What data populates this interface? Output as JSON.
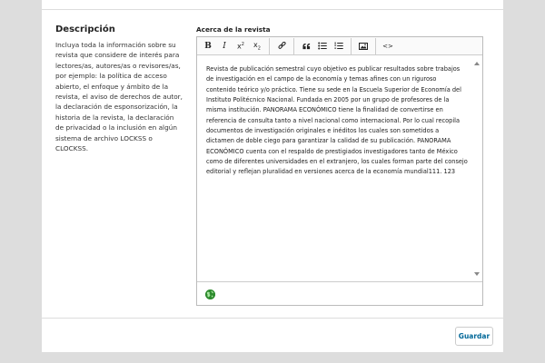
{
  "section": {
    "title": "Descripción",
    "description": "Incluya toda la información sobre su revista que considere de interés para lectores/as, autores/as o revisores/as, por ejemplo: la política de acceso abierto, el enfoque y ámbito de la revista, el aviso de derechos de autor, la declaración de esponsorización, la historia de la revista, la declaración de privacidad o la inclusión en algún sistema de archivo LOCKSS o CLOCKSS."
  },
  "field": {
    "label": "Acerca de la revista",
    "content": "Revista de publicación semestral cuyo objetivo es publicar resultados sobre trabajos de investigación en el campo de la economía y temas afines con un riguroso contenido teórico y/o práctico. Tiene su sede en la Escuela Superior de Economía del Instituto Politécnico Nacional. Fundada en 2005 por un grupo de profesores de la misma institución. PANORAMA ECONÓMICO tiene la finalidad de convertirse en referencia de consulta tanto a nivel nacional como internacional. Por lo cual recopila documentos de investigación originales e inéditos los cuales son sometidos a dictamen de doble ciego para garantizar la calidad de su publicación. PANORAMA ECONÓMICO cuenta con el respaldo de prestigiados investigadores tanto de México como de diferentes universidades en el extranjero, los cuales forman parte del consejo editorial y reflejan pluralidad en versiones acerca de la economía mundial111. 123"
  },
  "toolbar": {
    "bold": "B",
    "italic": "I",
    "superscript": "x",
    "superscript_mark": "2",
    "subscript": "x",
    "subscript_mark": "2",
    "code": "<>"
  },
  "icons": {
    "bold": "bold-icon",
    "italic": "italic-icon",
    "superscript": "superscript-icon",
    "subscript": "subscript-icon",
    "link": "link-icon",
    "blockquote": "blockquote-icon",
    "bullet_list": "bullet-list-icon",
    "numbered_list": "numbered-list-icon",
    "image": "image-icon",
    "source_code": "code-icon",
    "language": "globe-icon"
  },
  "colors": {
    "primary": "#006798",
    "globe": "#2e8b2e"
  },
  "actions": {
    "save": "Guardar"
  }
}
